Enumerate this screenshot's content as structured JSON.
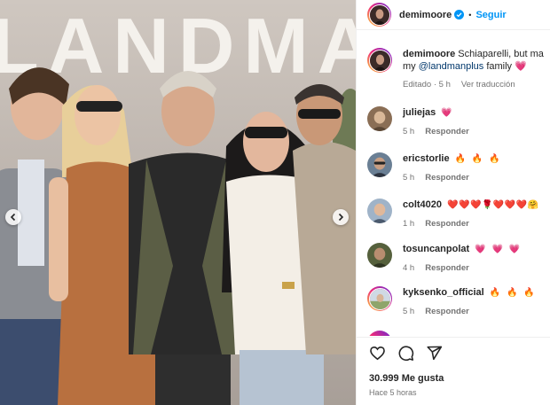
{
  "post": {
    "author": "demimoore",
    "follow_label": "Seguir",
    "separator": "•",
    "banner_text": "LANDMAN",
    "prev_label": "Anterior",
    "next_label": "Siguiente"
  },
  "caption": {
    "username": "demimoore",
    "text": "Schiaparelli, but ma",
    "text_line2_before": "my ",
    "mention": "@landmanplus",
    "text_line2_after": " family",
    "emoji": "💗",
    "meta_edited": "Editado · 5 h",
    "meta_translate": "Ver traducción"
  },
  "comments": [
    {
      "username": "juliejas",
      "text": "💗",
      "time": "5 h",
      "reply": "Responder"
    },
    {
      "username": "ericstorlie",
      "text": "🔥 🔥 🔥",
      "time": "5 h",
      "reply": "Responder"
    },
    {
      "username": "colt4020",
      "text": "❤️❤️❤️🌹❤️❤️❤️🤗",
      "time": "1 h",
      "reply": "Responder"
    },
    {
      "username": "tosuncanpolat",
      "text": "💗 💗 💗",
      "time": "4 h",
      "reply": "Responder"
    },
    {
      "username": "kyksenko_official",
      "text": "🔥 🔥 🔥",
      "time": "5 h",
      "reply": "Responder"
    }
  ],
  "actions": {
    "likes": "30.999 Me gusta",
    "time_ago": "Hace 5 horas"
  },
  "colors": {
    "accent": "#0095f6",
    "secondary_text": "#737373",
    "primary_text": "#262626",
    "mention": "#00376b"
  }
}
